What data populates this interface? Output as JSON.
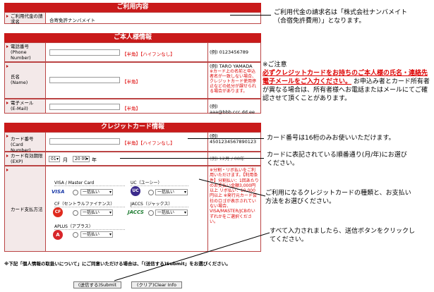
{
  "usage": {
    "header": "ご利用内容",
    "label": "ご利用代金の請求名",
    "value": "合寄免許ナンバメイト",
    "callout_line1": "ご利用代金の請求名は「株式会社ナンバメイト",
    "callout_line2": "（合宿免許費用）」となります。"
  },
  "personal": {
    "header": "ご本人様情報",
    "phone_label": "電話番号\n(Phone Number)",
    "phone_note": "【半角】【ハイフンなし】",
    "phone_example": "(例) 0123456789",
    "name_label": "氏名\n(Name)",
    "name_note": "【半角】",
    "name_example": "(例) TARO YAMADA",
    "name_example_note": "※カード上の名前と申込者名が一致しない場合、クレジットカード使用停止などの処分が課せられる場合があります。",
    "email_label": "電子メール\n(E-Mail)",
    "email_note": "【半角】",
    "email_example": "(例) aaa@bbb.ccc.dd.ee"
  },
  "caution": {
    "title": "※ご注意",
    "red_text": "必ずクレジットカードをお持ちのご本人様の氏名・連絡先電子メールをご入力ください。",
    "body": "お申込み者とカード所有者が異なる場合は、所有者様へお電話またはメールにてご確認させて頂くことがあります。"
  },
  "card": {
    "header": "クレジットカード情報",
    "number_label": "カード番号\n(Card Number)",
    "number_note": "【半角】【ハイフンなし】",
    "number_example": "(例) 4501234567890123",
    "expiry_label": "カード有効期限\n(EXP)",
    "expiry_month": "01",
    "expiry_month_unit": "月",
    "expiry_year": "20 09",
    "expiry_year_unit": "年",
    "expiry_example": "(例) 12月 / 08年",
    "payment_label": "カード支払方法",
    "brands": [
      {
        "name": "VISA / Master Card",
        "logo": "VISA",
        "option": "一括払い"
      },
      {
        "name": "UC（ユーシー）",
        "logo": "UC",
        "option": "一括払い"
      },
      {
        "name": "CF（セントラルファイナンス）",
        "logo": "CF",
        "option": "一括払い"
      },
      {
        "name": "JACCS（ジャックス）",
        "logo": "JACCS",
        "option": "一括払い"
      },
      {
        "name": "APLUS（アプラス）",
        "logo": "A",
        "option": "一括払い"
      }
    ],
    "payment_note": "※分割・リボ払いをご利用いただけます。【利用条件】分割払い：1回あたりのお支払い金額3,000円以上 リボ払い：10,000円以上 ※発行元カード会社のロゴが表示されていない場合、VISA/MASTER/JCBのいずれかをご選択ください。",
    "callout_number": "カード番号は16桁のみお使いいただけます。",
    "callout_expiry1": "カードに表記されている順番通り(月/年)にお選び",
    "callout_expiry2": "ください。",
    "callout_payment1": "ご利用になるクレジットカードの種類と、お支払い",
    "callout_payment2": "方法をお選びください。"
  },
  "footer": {
    "agreement": "※下記「個人情報の取扱いについて」にご同意いただける場合は、「(送信する)Submit」をお選びください。",
    "submit_label": "(送信する)Submit",
    "clear_label": "(クリア)Clear Info",
    "callout1": "すべて入力されましたら、送信ボタンをクリックし",
    "callout2": "てください。"
  }
}
